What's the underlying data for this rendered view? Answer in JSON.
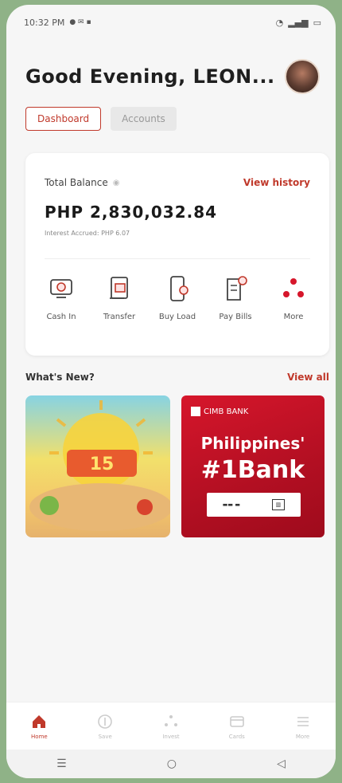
{
  "status_bar": {
    "time": "10:32 PM",
    "right_text": ""
  },
  "greeting": "Good Evening, LEON...",
  "tabs": [
    {
      "label": "Dashboard",
      "active": true
    },
    {
      "label": "Accounts",
      "active": false
    }
  ],
  "balance": {
    "label": "Total Balance",
    "view_history": "View history",
    "amount": "PHP 2,830,032.84",
    "interest": "Interest Accrued: PHP 6.07"
  },
  "actions": [
    {
      "label": "Cash In",
      "icon": "cash-in-icon"
    },
    {
      "label": "Transfer",
      "icon": "transfer-icon"
    },
    {
      "label": "Buy Load",
      "icon": "buy-load-icon"
    },
    {
      "label": "Pay Bills",
      "icon": "pay-bills-icon"
    },
    {
      "label": "More",
      "icon": "more-icon"
    }
  ],
  "whats_new": {
    "title": "What's New?",
    "view_all": "View all",
    "promo2": {
      "brand": "CIMB BANK",
      "line1": "Philippines'",
      "line2": "#1Bank"
    }
  },
  "bottom_nav": [
    {
      "label": "Home",
      "icon": "home-icon",
      "active": true
    },
    {
      "label": "Save",
      "icon": "save-icon",
      "active": false
    },
    {
      "label": "Invest",
      "icon": "invest-icon",
      "active": false
    },
    {
      "label": "Cards",
      "icon": "cards-icon",
      "active": false
    },
    {
      "label": "More",
      "icon": "menu-icon",
      "active": false
    }
  ],
  "colors": {
    "accent": "#c0392b",
    "promo_red": "#d6162b"
  }
}
